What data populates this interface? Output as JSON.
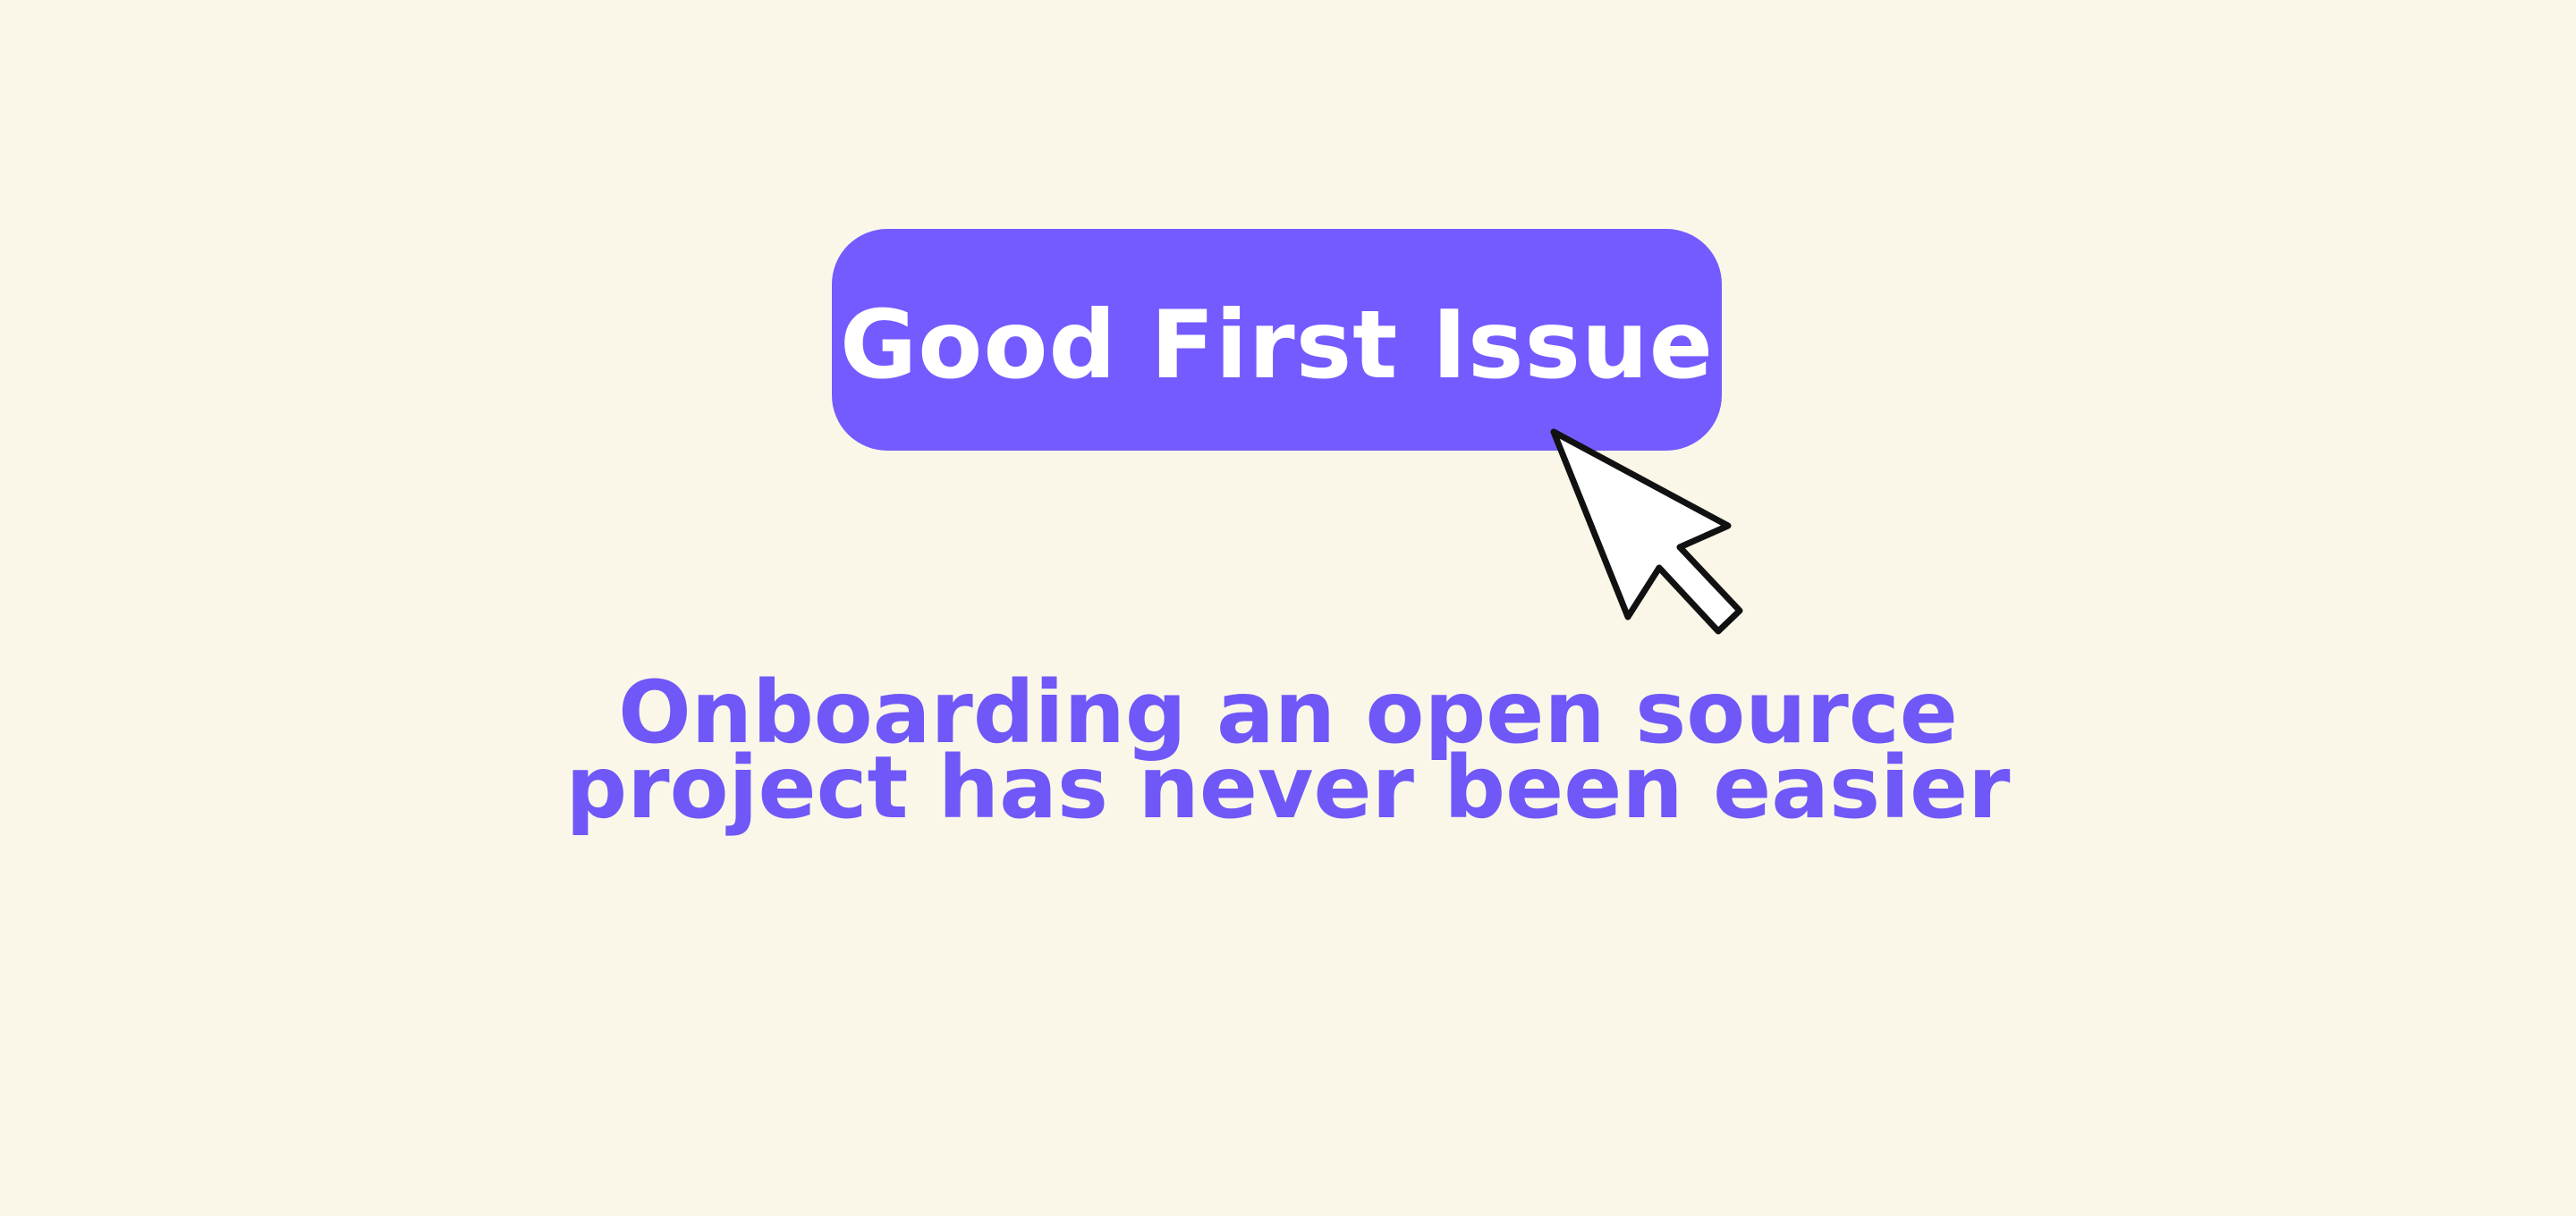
{
  "cta": {
    "label": "Good First Issue"
  },
  "tagline": {
    "line1": "Onboarding an open source",
    "line2": "project has never been easier"
  },
  "icons": {
    "cursor": "mouse-pointer-arrow"
  },
  "colors": {
    "background": "#faf7e9",
    "accent": "#735bff",
    "tagline": "#6f58f7",
    "button_text": "#ffffff",
    "cursor_fill": "#ffffff",
    "cursor_stroke": "#111111"
  }
}
